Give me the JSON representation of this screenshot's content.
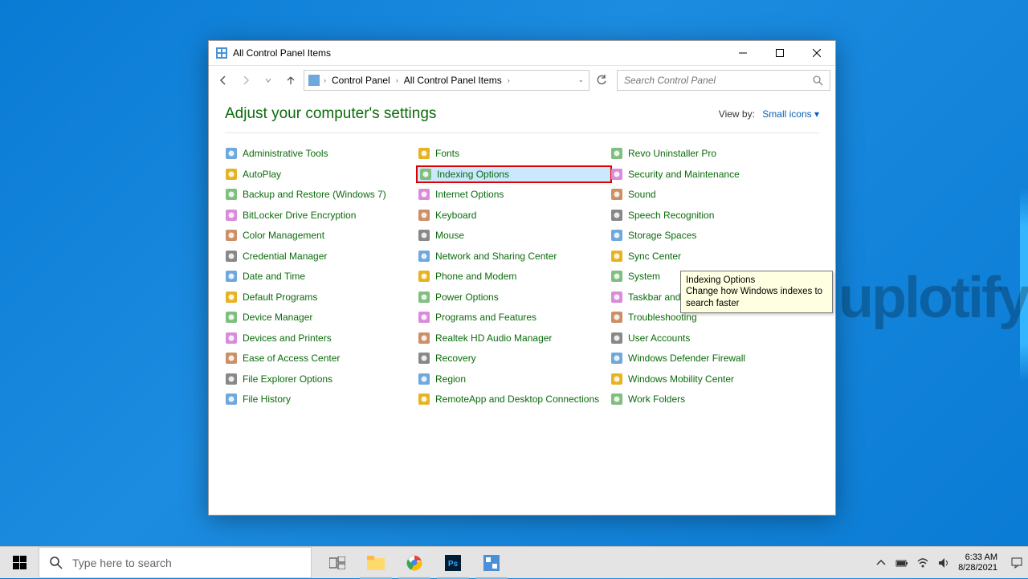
{
  "watermark": "uplotify",
  "window": {
    "title": "All Control Panel Items",
    "breadcrumbs": [
      "Control Panel",
      "All Control Panel Items"
    ],
    "search_placeholder": "Search Control Panel",
    "heading": "Adjust your computer's settings",
    "viewby_label": "View by:",
    "viewby_value": "Small icons",
    "highlighted": "Indexing Options",
    "items": [
      "Administrative Tools",
      "AutoPlay",
      "Backup and Restore (Windows 7)",
      "BitLocker Drive Encryption",
      "Color Management",
      "Credential Manager",
      "Date and Time",
      "Default Programs",
      "Device Manager",
      "Devices and Printers",
      "Ease of Access Center",
      "File Explorer Options",
      "File History",
      "Fonts",
      "Indexing Options",
      "Internet Options",
      "Keyboard",
      "Mouse",
      "Network and Sharing Center",
      "Phone and Modem",
      "Power Options",
      "Programs and Features",
      "Realtek HD Audio Manager",
      "Recovery",
      "Region",
      "RemoteApp and Desktop Connections",
      "Revo Uninstaller Pro",
      "Security and Maintenance",
      "Sound",
      "Speech Recognition",
      "Storage Spaces",
      "Sync Center",
      "System",
      "Taskbar and Navigation",
      "Troubleshooting",
      "User Accounts",
      "Windows Defender Firewall",
      "Windows Mobility Center",
      "Work Folders"
    ]
  },
  "tooltip": {
    "title": "Indexing Options",
    "body": "Change how Windows indexes to search faster"
  },
  "taskbar": {
    "search_placeholder": "Type here to search",
    "time": "6:33 AM",
    "date": "8/28/2021"
  }
}
